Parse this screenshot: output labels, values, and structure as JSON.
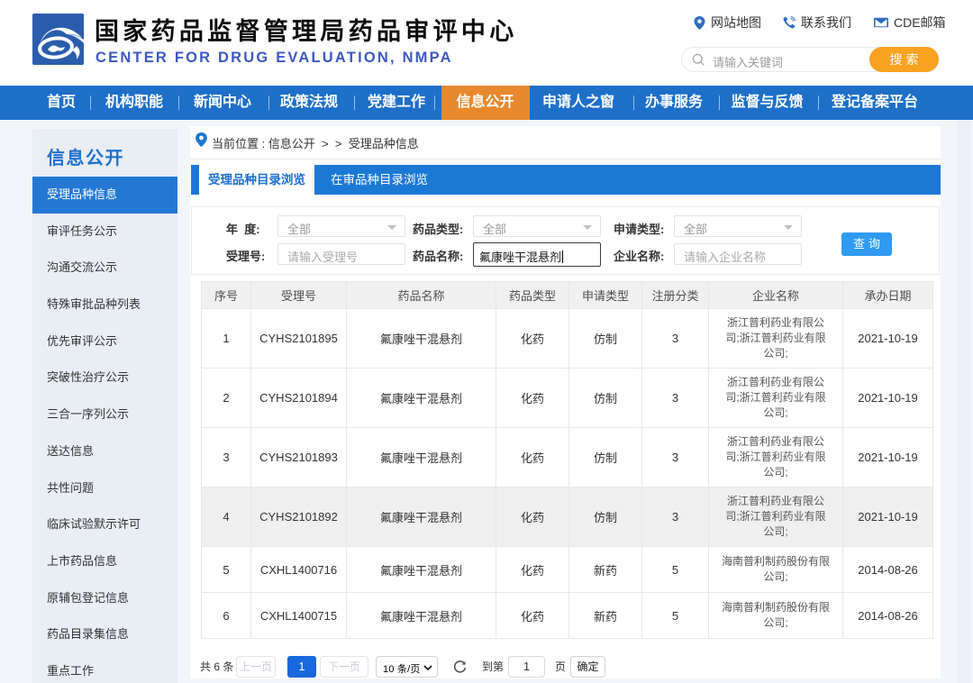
{
  "header": {
    "title": "国家药品监督管理局药品审评中心",
    "subtitle": "CENTER FOR DRUG EVALUATION, NMPA",
    "links": [
      {
        "icon": "location-pin-icon",
        "label": "网站地图"
      },
      {
        "icon": "phone-icon",
        "label": "联系我们"
      },
      {
        "icon": "envelope-icon",
        "label": "CDE邮箱"
      }
    ],
    "search": {
      "placeholder": "请输入关键词",
      "button_label": "搜索"
    }
  },
  "nav": {
    "items": [
      {
        "label": "首页",
        "active": false
      },
      {
        "label": "机构职能",
        "active": false
      },
      {
        "label": "新闻中心",
        "active": false
      },
      {
        "label": "政策法规",
        "active": false
      },
      {
        "label": "党建工作",
        "active": false
      },
      {
        "label": "信息公开",
        "active": true
      },
      {
        "label": "申请人之窗",
        "active": false
      },
      {
        "label": "办事服务",
        "active": false
      },
      {
        "label": "监督与反馈",
        "active": false
      },
      {
        "label": "登记备案平台",
        "active": false
      }
    ]
  },
  "sidebar": {
    "title": "信息公开",
    "items": [
      {
        "label": "受理品种信息",
        "active": true
      },
      {
        "label": "审评任务公示",
        "active": false
      },
      {
        "label": "沟通交流公示",
        "active": false
      },
      {
        "label": "特殊审批品种列表",
        "active": false
      },
      {
        "label": "优先审评公示",
        "active": false
      },
      {
        "label": "突破性治疗公示",
        "active": false
      },
      {
        "label": "三合一序列公示",
        "active": false
      },
      {
        "label": "送达信息",
        "active": false
      },
      {
        "label": "共性问题",
        "active": false
      },
      {
        "label": "临床试验默示许可",
        "active": false
      },
      {
        "label": "上市药品信息",
        "active": false
      },
      {
        "label": "原辅包登记信息",
        "active": false
      },
      {
        "label": "药品目录集信息",
        "active": false
      },
      {
        "label": "重点工作",
        "active": false
      }
    ]
  },
  "breadcrumb": {
    "text": "当前位置 : 信息公开  >  >  受理品种信息"
  },
  "tabs": [
    {
      "label": "受理品种目录浏览",
      "active": true
    },
    {
      "label": "在审品种目录浏览",
      "active": false
    }
  ],
  "filters": {
    "year_label": "年  度:",
    "year_value": "全部",
    "drug_type_label": "药品类型:",
    "drug_type_value": "全部",
    "apply_type_label": "申请类型:",
    "apply_type_value": "全部",
    "acceptance_no_label": "受理号:",
    "acceptance_no_placeholder": "请输入受理号",
    "drug_name_label": "药品名称:",
    "drug_name_value": "氟康唑干混悬剂",
    "company_label": "企业名称:",
    "company_placeholder": "请输入企业名称",
    "query_button": "查询"
  },
  "table": {
    "columns": [
      "序号",
      "受理号",
      "药品名称",
      "药品类型",
      "申请类型",
      "注册分类",
      "企业名称",
      "承办日期"
    ],
    "rows": [
      [
        "1",
        "CYHS2101895",
        "氟康唑干混悬剂",
        "化药",
        "仿制",
        "3",
        "浙江普利药业有限公司;浙江普利药业有限公司;",
        "2021-10-19"
      ],
      [
        "2",
        "CYHS2101894",
        "氟康唑干混悬剂",
        "化药",
        "仿制",
        "3",
        "浙江普利药业有限公司;浙江普利药业有限公司;",
        "2021-10-19"
      ],
      [
        "3",
        "CYHS2101893",
        "氟康唑干混悬剂",
        "化药",
        "仿制",
        "3",
        "浙江普利药业有限公司;浙江普利药业有限公司;",
        "2021-10-19"
      ],
      [
        "4",
        "CYHS2101892",
        "氟康唑干混悬剂",
        "化药",
        "仿制",
        "3",
        "浙江普利药业有限公司;浙江普利药业有限公司;",
        "2021-10-19"
      ],
      [
        "5",
        "CXHL1400716",
        "氟康唑干混悬剂",
        "化药",
        "新药",
        "5",
        "海南普利制药股份有限公司;",
        "2014-08-26"
      ],
      [
        "6",
        "CXHL1400715",
        "氟康唑干混悬剂",
        "化药",
        "新药",
        "5",
        "海南普利制药股份有限公司;",
        "2014-08-26"
      ]
    ],
    "highlighted_row_index": 3
  },
  "pagination": {
    "total_text": "共 6 条",
    "prev_label": "上一页",
    "current_page": "1",
    "next_label": "下一页",
    "page_size_value": "10 条/页",
    "goto_prefix": "到第",
    "goto_value": "1",
    "goto_suffix": "页",
    "confirm_label": "确定"
  },
  "colors": {
    "nav_blue": "#1e6fc8",
    "nav_active_orange": "#e8892d",
    "tab_blue": "#1b79d6",
    "sidebar_active_blue": "#2478d4",
    "search_orange": "#f8a21f",
    "query_button_blue": "#2f9bf2",
    "page_active_blue": "#1a6ee8",
    "subtitle_blue": "#3c59c4",
    "logo_blue": "#2b5dad"
  }
}
